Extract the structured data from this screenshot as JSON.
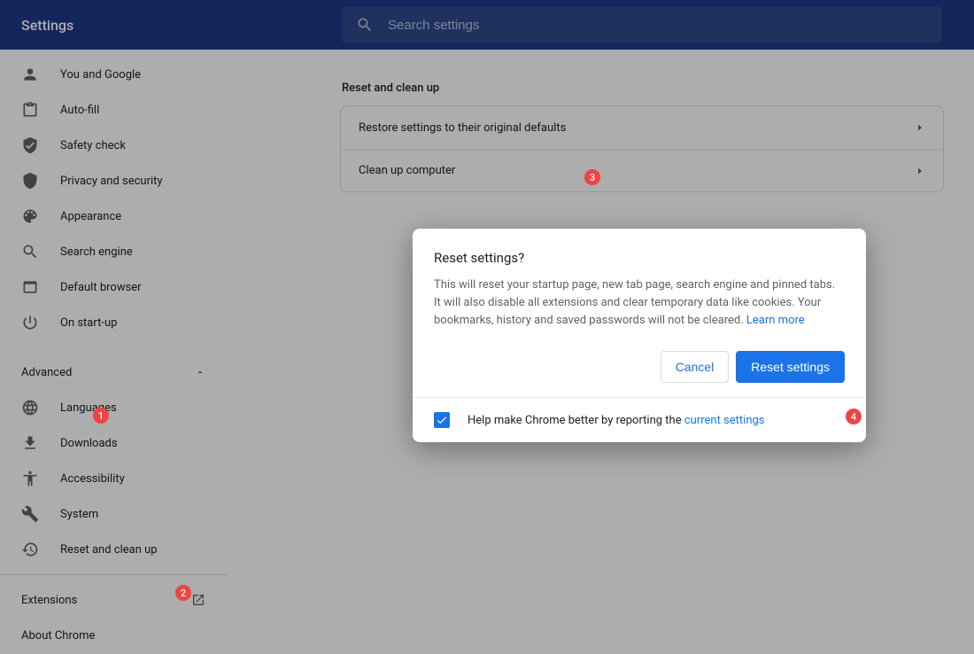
{
  "header": {
    "title": "Settings",
    "search_placeholder": "Search settings"
  },
  "sidebar": {
    "items": [
      {
        "label": "You and Google"
      },
      {
        "label": "Auto-fill"
      },
      {
        "label": "Safety check"
      },
      {
        "label": "Privacy and security"
      },
      {
        "label": "Appearance"
      },
      {
        "label": "Search engine"
      },
      {
        "label": "Default browser"
      },
      {
        "label": "On start-up"
      }
    ],
    "advanced_label": "Advanced",
    "advanced_items": [
      {
        "label": "Languages"
      },
      {
        "label": "Downloads"
      },
      {
        "label": "Accessibility"
      },
      {
        "label": "System"
      },
      {
        "label": "Reset and clean up"
      }
    ],
    "extensions_label": "Extensions",
    "about_label": "About Chrome"
  },
  "main": {
    "section_title": "Reset and clean up",
    "rows": [
      {
        "label": "Restore settings to their original defaults"
      },
      {
        "label": "Clean up computer"
      }
    ]
  },
  "dialog": {
    "title": "Reset settings?",
    "body": "This will reset your startup page, new tab page, search engine and pinned tabs. It will also disable all extensions and clear temporary data like cookies. Your bookmarks, history and saved passwords will not be cleared. ",
    "learn_more": "Learn more",
    "cancel": "Cancel",
    "confirm": "Reset settings",
    "footer_text": "Help make Chrome better by reporting the ",
    "footer_link": "current settings"
  },
  "annotations": {
    "1": "1",
    "2": "2",
    "3": "3",
    "4": "4"
  }
}
